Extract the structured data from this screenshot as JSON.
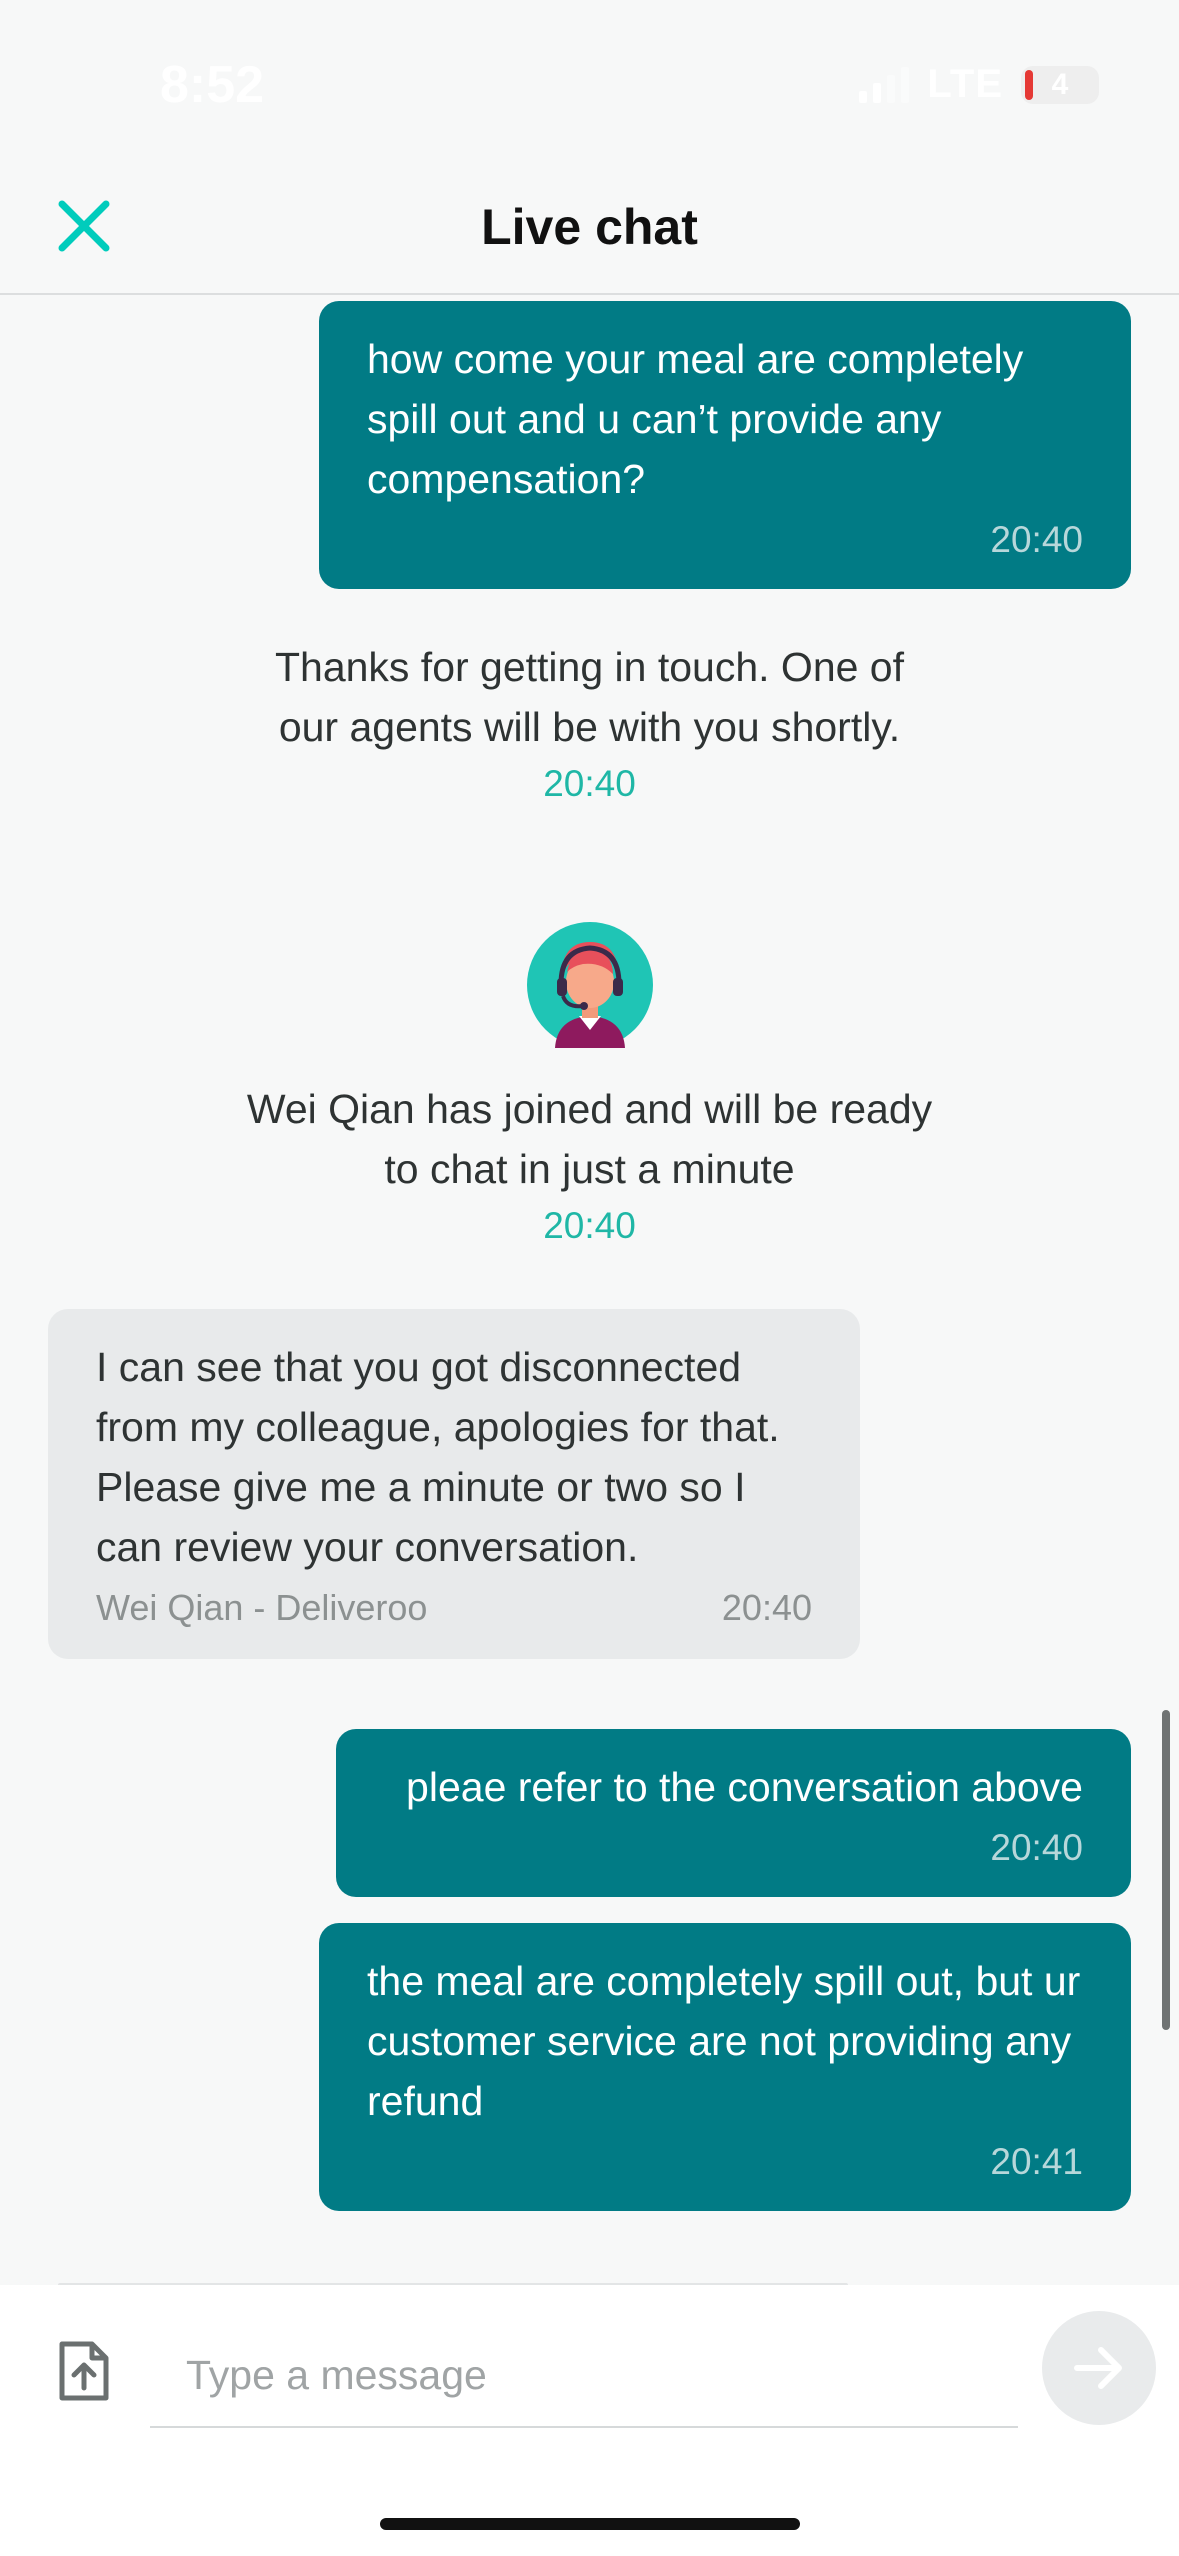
{
  "status_bar": {
    "time": "8:52",
    "network": "LTE",
    "battery": "4"
  },
  "header": {
    "title": "Live chat",
    "close_icon": "close-icon"
  },
  "messages": [
    {
      "type": "outgoing",
      "text": "how come your meal are completely spill out and u can’t provide any compensation?",
      "time": "20:40"
    },
    {
      "type": "system",
      "text": "Thanks for getting in touch. One of our agents will be with you shortly.",
      "time": "20:40"
    },
    {
      "type": "agent_joined",
      "avatar": "agent-avatar-icon",
      "text": "Wei Qian has joined and will be ready to chat in just a minute",
      "time": "20:40"
    },
    {
      "type": "incoming",
      "text": "I can see that you got disconnected from my colleague, apologies for that. Please give me a minute or two so I can review your conversation.",
      "sender": "Wei Qian - Deliveroo",
      "time": "20:40"
    },
    {
      "type": "outgoing",
      "text": "pleae refer to the conversation above",
      "time": "20:40"
    },
    {
      "type": "outgoing",
      "text": "the meal are completely spill out, but ur customer service are not providing any refund",
      "time": "20:41"
    }
  ],
  "composer": {
    "placeholder": "Type a message",
    "attach_icon": "file-upload-icon",
    "send_icon": "arrow-right-icon"
  },
  "colors": {
    "accent": "#00ccbc",
    "outgoing_bubble": "#017b85",
    "incoming_bubble": "#e8eaeb",
    "timestamp_teal": "#1fb7a6"
  }
}
